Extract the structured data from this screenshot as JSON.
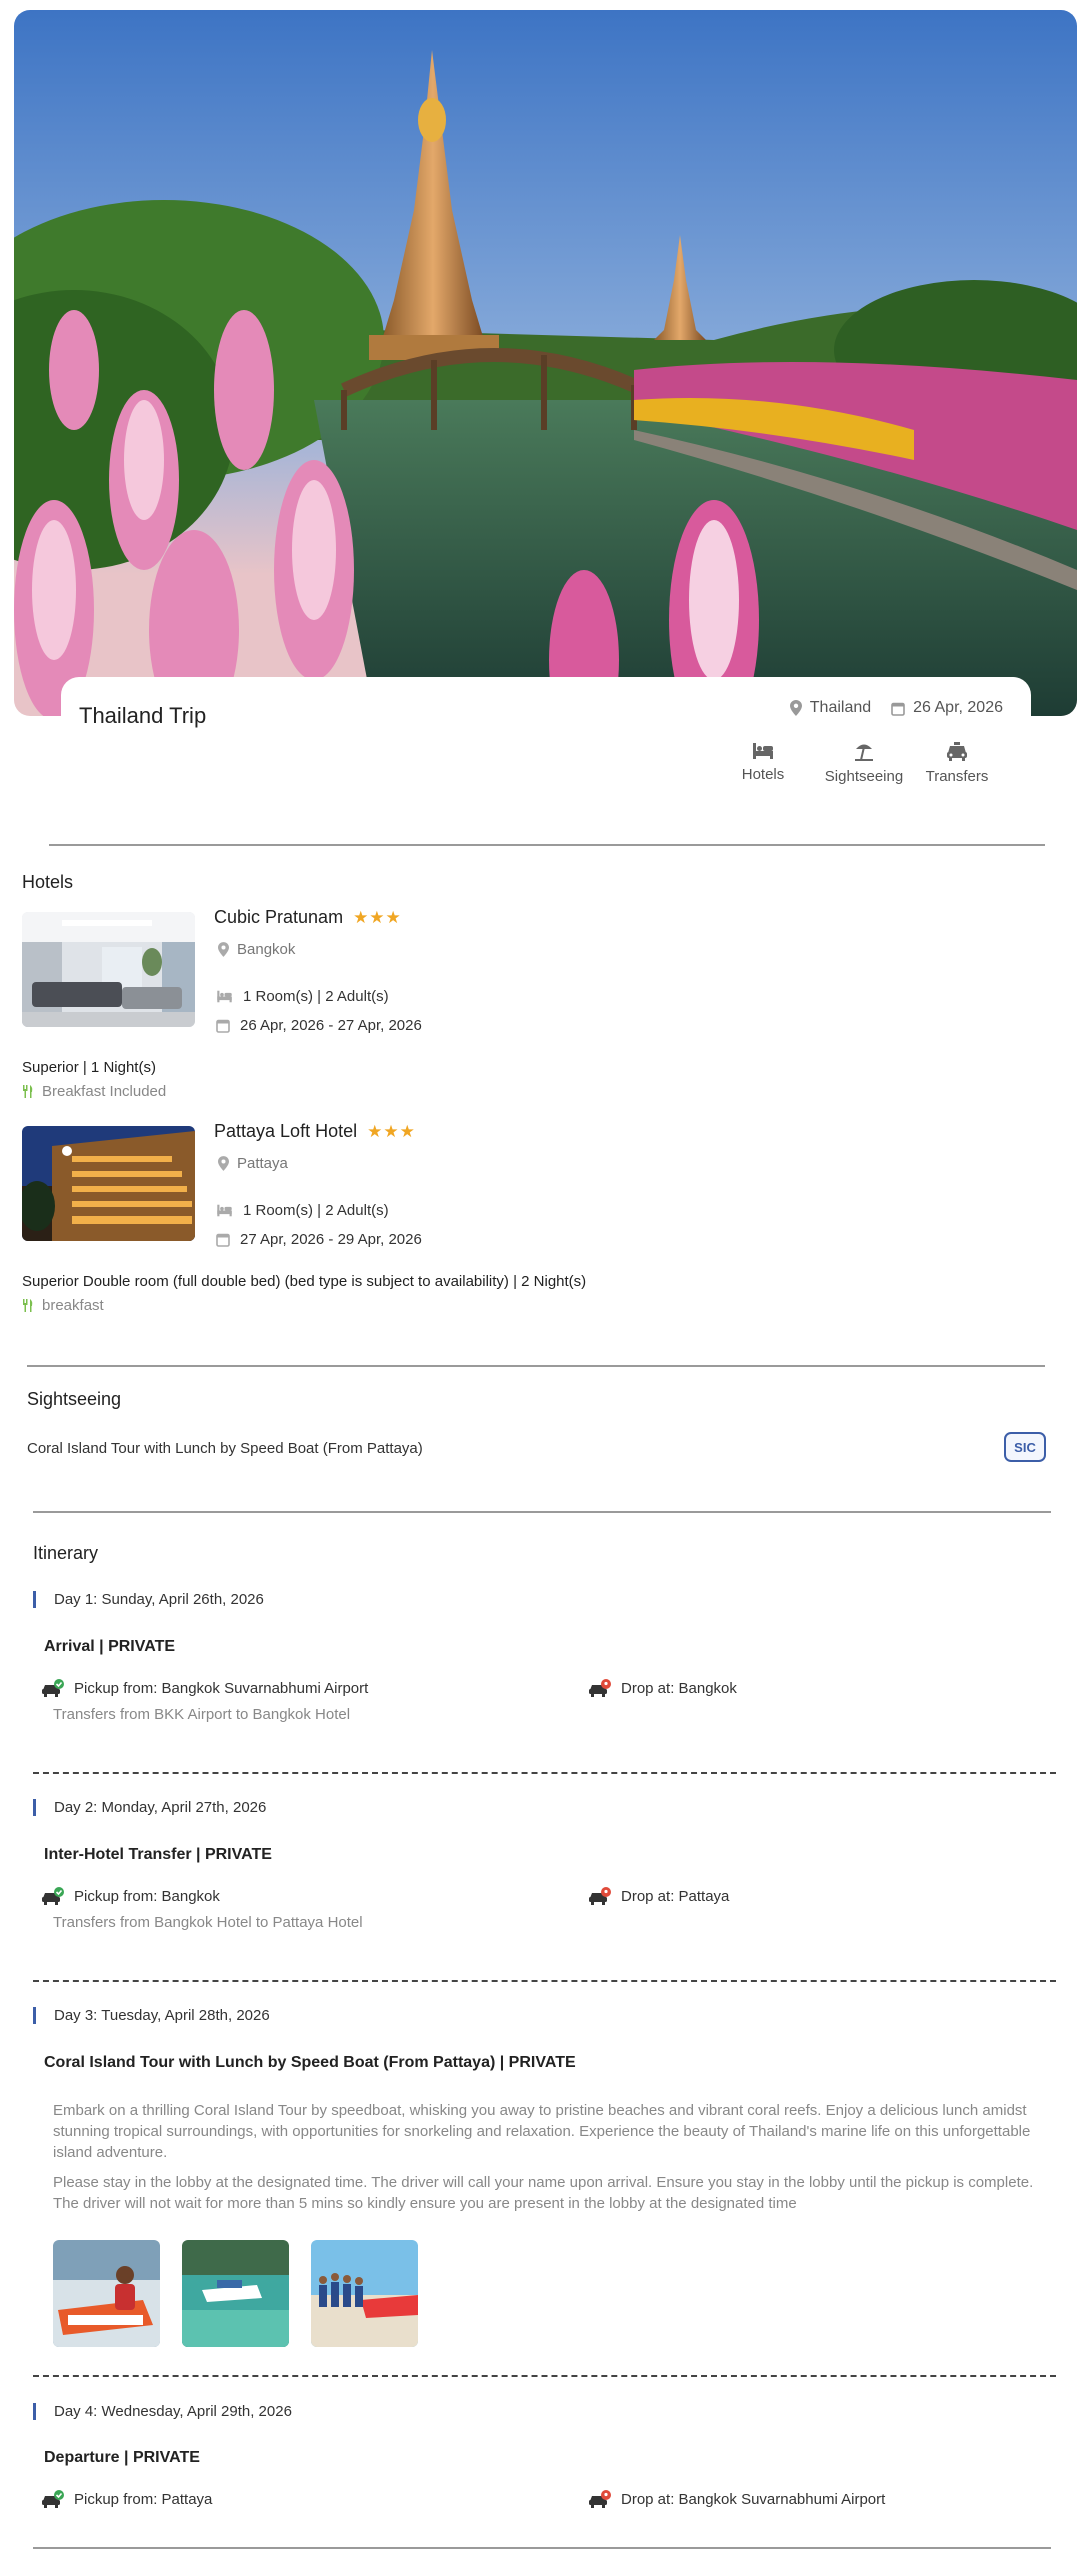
{
  "trip": {
    "title": "Thailand Trip",
    "location": "Thailand",
    "date": "26 Apr, 2026",
    "services": [
      {
        "label": "Hotels",
        "icon": "bed-icon"
      },
      {
        "label": "Sightseeing",
        "icon": "beach-umbrella-icon"
      },
      {
        "label": "Transfers",
        "icon": "taxi-icon"
      }
    ]
  },
  "hotels": {
    "section_title": "Hotels",
    "items": [
      {
        "name": "Cubic Pratunam",
        "stars": "★★★",
        "city": "Bangkok",
        "rooms": "1 Room(s) | 2 Adult(s)",
        "dates": "26 Apr, 2026 - 27 Apr, 2026",
        "room_type": "Superior | 1 Night(s)",
        "meal": "Breakfast Included"
      },
      {
        "name": "Pattaya Loft Hotel",
        "stars": "★★★",
        "city": "Pattaya",
        "rooms": "1 Room(s) | 2 Adult(s)",
        "dates": "27 Apr, 2026 - 29 Apr, 2026",
        "room_type": "Superior Double room (full double bed) (bed type is subject to availability) | 2 Night(s)",
        "meal": "breakfast"
      }
    ]
  },
  "sightseeing": {
    "section_title": "Sightseeing",
    "name": "Coral Island Tour with Lunch by Speed Boat (From Pattaya)",
    "badge": "SIC"
  },
  "itinerary": {
    "section_title": "Itinerary",
    "days": [
      {
        "heading": "Day 1: Sunday, April 26th, 2026",
        "title": "Arrival | PRIVATE",
        "pickup": "Pickup from: Bangkok Suvarnabhumi Airport",
        "drop": "Drop at: Bangkok",
        "note": "Transfers from BKK Airport to Bangkok Hotel"
      },
      {
        "heading": "Day 2: Monday, April 27th, 2026",
        "title": "Inter-Hotel Transfer | PRIVATE",
        "pickup": "Pickup from: Bangkok",
        "drop": "Drop at: Pattaya",
        "note": "Transfers from Bangkok Hotel to Pattaya Hotel"
      },
      {
        "heading": "Day 3: Tuesday, April 28th, 2026",
        "title": "Coral Island Tour with Lunch by Speed Boat (From Pattaya) | PRIVATE",
        "desc1": "Embark on a thrilling Coral Island Tour by speedboat, whisking you away to pristine beaches and vibrant coral reefs. Enjoy a delicious lunch amidst stunning tropical surroundings, with opportunities for snorkeling and relaxation. Experience the beauty of Thailand's marine life on this unforgettable island adventure.",
        "desc2": "Please stay in the lobby at the designated time. The driver will call your name upon arrival. Ensure you stay in the lobby until the pickup is complete. The driver will not wait for more than 5 mins so kindly ensure you are present in the lobby at the designated time"
      },
      {
        "heading": "Day 4: Wednesday, April 29th, 2026",
        "title": "Departure | PRIVATE",
        "pickup": "Pickup from: Pattaya",
        "drop": "Drop at: Bangkok Suvarnabhumi Airport"
      }
    ]
  },
  "colors": {
    "accent": "#3c5ea8",
    "star": "#f0a623",
    "meal_icon": "#7bbf4e",
    "pickup_badge": "#3aa655",
    "drop_badge": "#e04a3a"
  }
}
